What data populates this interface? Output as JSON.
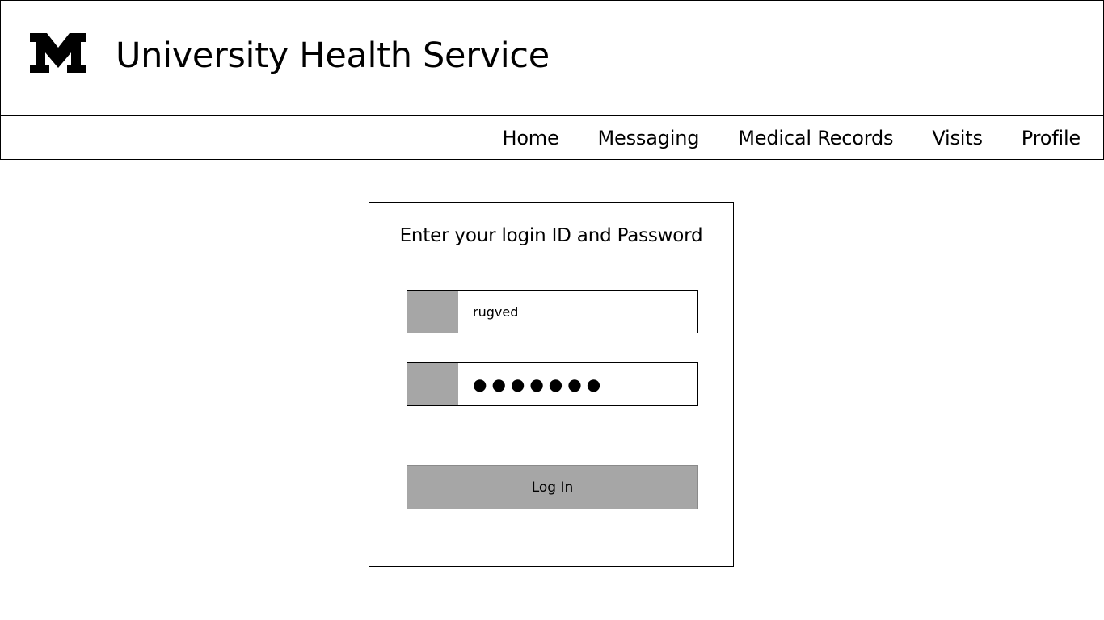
{
  "header": {
    "logo": {
      "icon": "block-m-icon",
      "color": "#000000"
    },
    "title": "University Health Service"
  },
  "nav": {
    "items": [
      {
        "label": "Home"
      },
      {
        "label": "Messaging"
      },
      {
        "label": "Medical Records"
      },
      {
        "label": "Visits"
      },
      {
        "label": "Profile"
      }
    ]
  },
  "login": {
    "heading": "Enter your login ID and Password",
    "username": {
      "value": "rugved",
      "icon": "user-icon"
    },
    "password": {
      "masked_value": "●●●●●●●",
      "icon": "lock-icon"
    },
    "button_label": "Log In"
  },
  "colors": {
    "field_icon_bg": "#a6a6a6",
    "button_bg": "#a6a6a6",
    "border": "#000000"
  }
}
